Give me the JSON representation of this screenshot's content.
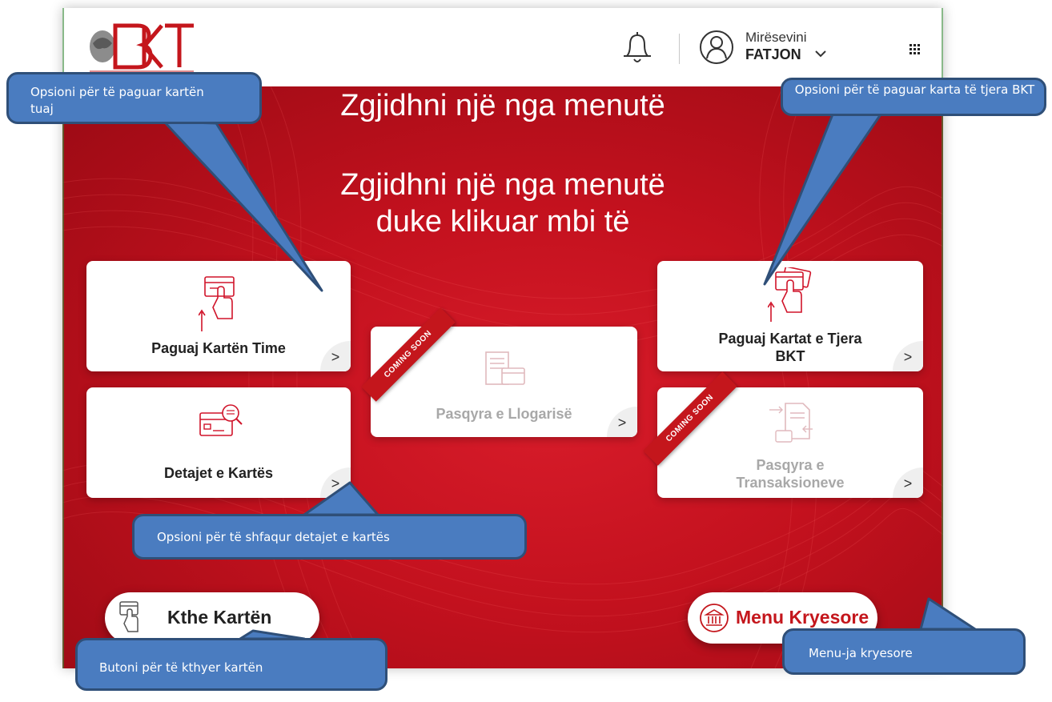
{
  "header": {
    "logo_text": "BKT",
    "welcome": "Mirësevini",
    "username": "FATJON",
    "icons": [
      "bell-icon",
      "user-avatar-icon",
      "chevron-down-icon",
      "apps-grid-icon"
    ]
  },
  "headline": {
    "line1": "Zgjidhni një nga menutë",
    "line2": "duke klikuar mbi të"
  },
  "tiles": [
    {
      "label": "Paguaj Kartën Time",
      "arrow": ">",
      "icon": "pay-card-icon"
    },
    {
      "label": "Detajet e Kartës",
      "arrow": ">",
      "icon": "card-details-icon"
    },
    {
      "label": "Pasqyra e Llogarisë",
      "arrow": ">",
      "icon": "account-statement-icon",
      "badge": "COMING SOON"
    },
    {
      "label_line1": "Paguaj Kartat e Tjera",
      "label_line2": "BKT",
      "arrow": ">",
      "icon": "pay-other-cards-icon"
    },
    {
      "label_line1": "Pasqyra e",
      "label_line2": "Transaksioneve",
      "arrow": ">",
      "icon": "transactions-icon",
      "badge": "COMING SOON"
    }
  ],
  "buttons": {
    "return_card": "Kthe Kartën",
    "main_menu": "Menu Kryesore"
  },
  "callouts": {
    "pay_own": "Opsioni për të paguar kartën tuaj",
    "pay_other": "Opsioni për të paguar karta të tjera BKT",
    "details": "Opsioni për të shfaqur detajet e kartës",
    "main_menu": "Menu-ja kryesore",
    "return_card": "Butoni për të kthyer kartën"
  },
  "colors": {
    "brand_red": "#c3111e",
    "callout_blue": "#4a7cc0",
    "callout_border": "#2f4f78"
  }
}
